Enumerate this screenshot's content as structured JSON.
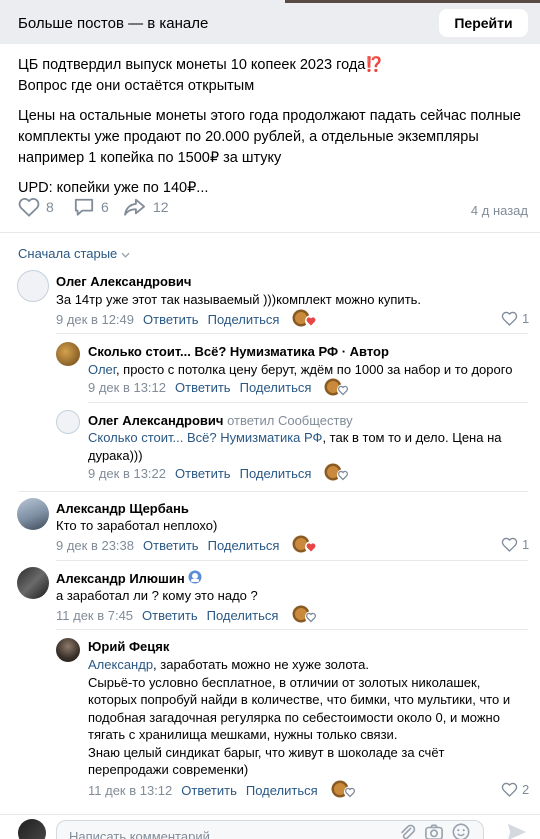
{
  "topbar": {
    "title": "Больше постов — в канале",
    "button": "Перейти"
  },
  "post": {
    "line1": "ЦБ подтвердил выпуск монеты 10 копеек 2023 года",
    "line1_emoji": "⁉️",
    "line2": "Вопрос где они остаётся открытым",
    "para2": "Цены на остальные монеты этого года продолжают падать сейчас полные комплекты уже продают по 20.000 рублей, а отдельные экземпляры например 1 копейка по 1500₽ за штуку",
    "para3": "UPD: копейки уже по 140₽..."
  },
  "actions": {
    "likes": "8",
    "comments": "6",
    "shares": "12",
    "ago": "4 д назад"
  },
  "sort_label": "Сначала старые",
  "comments": [
    {
      "author": "Олег Александрович",
      "text": "За 14тр уже этот так называемый )))комплект можно купить.",
      "date": "9 дек в 12:49",
      "reply": "Ответить",
      "share": "Поделиться",
      "likes": "1"
    },
    {
      "author": "Сколько стоит... Всё? Нумизматика РФ · Автор",
      "mention": "Олег",
      "text": ", просто с потолка цену берут, ждём по 1000 за набор и то дорого",
      "date": "9 дек в 13:12",
      "reply": "Ответить",
      "share": "Поделиться"
    },
    {
      "author": "Олег Александрович",
      "replied": "ответил Сообществу",
      "mention": "Сколько стоит... Всё? Нумизматика РФ",
      "text": ", так в том то и дело. Цена на дурака)))",
      "date": "9 дек в 13:22",
      "reply": "Ответить",
      "share": "Поделиться"
    },
    {
      "author": "Александр Щербань",
      "text": "Кто то заработал неплохо)",
      "date": "9 дек в 23:38",
      "reply": "Ответить",
      "share": "Поделиться",
      "likes": "1"
    },
    {
      "author": "Александр Илюшин",
      "text": "а заработал ли ? кому это надо ?",
      "date": "11 дек в 7:45",
      "reply": "Ответить",
      "share": "Поделиться"
    },
    {
      "author": "Юрий Фецяк",
      "mention": "Александр",
      "text_first": ", заработать можно не хуже золота.",
      "text_rest": "Сырьё-то условно бесплатное, в отличии от золотых николашек, которых попробуй найди в количестве, что бимки, что мультики, что и подобная загадочная регулярка по себестоимости около 0, и можно тягать с хранилища мешками, нужны только связи.\nЗнаю целый синдикат барыг, что живут в шоколаде за счёт перепродажи современки)",
      "date": "11 дек в 13:12",
      "reply": "Ответить",
      "share": "Поделиться",
      "likes": "2"
    }
  ],
  "composer": {
    "placeholder": "Написать комментарий..."
  },
  "colors": {
    "link": "#2a5885",
    "secondary": "#818c99",
    "heart_red": "#e64646",
    "topbar_bg": "#ebedf0"
  }
}
